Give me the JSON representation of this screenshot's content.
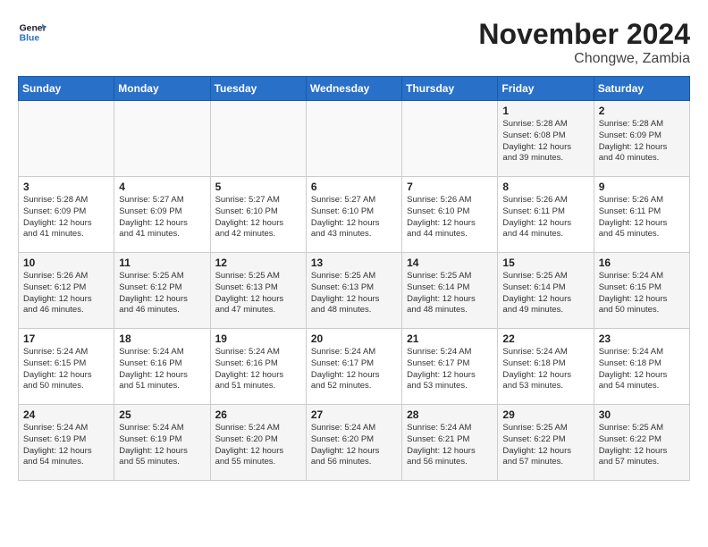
{
  "header": {
    "logo_line1": "General",
    "logo_line2": "Blue",
    "month": "November 2024",
    "location": "Chongwe, Zambia"
  },
  "days_of_week": [
    "Sunday",
    "Monday",
    "Tuesday",
    "Wednesday",
    "Thursday",
    "Friday",
    "Saturday"
  ],
  "weeks": [
    [
      {
        "day": "",
        "info": ""
      },
      {
        "day": "",
        "info": ""
      },
      {
        "day": "",
        "info": ""
      },
      {
        "day": "",
        "info": ""
      },
      {
        "day": "",
        "info": ""
      },
      {
        "day": "1",
        "info": "Sunrise: 5:28 AM\nSunset: 6:08 PM\nDaylight: 12 hours\nand 39 minutes."
      },
      {
        "day": "2",
        "info": "Sunrise: 5:28 AM\nSunset: 6:09 PM\nDaylight: 12 hours\nand 40 minutes."
      }
    ],
    [
      {
        "day": "3",
        "info": "Sunrise: 5:28 AM\nSunset: 6:09 PM\nDaylight: 12 hours\nand 41 minutes."
      },
      {
        "day": "4",
        "info": "Sunrise: 5:27 AM\nSunset: 6:09 PM\nDaylight: 12 hours\nand 41 minutes."
      },
      {
        "day": "5",
        "info": "Sunrise: 5:27 AM\nSunset: 6:10 PM\nDaylight: 12 hours\nand 42 minutes."
      },
      {
        "day": "6",
        "info": "Sunrise: 5:27 AM\nSunset: 6:10 PM\nDaylight: 12 hours\nand 43 minutes."
      },
      {
        "day": "7",
        "info": "Sunrise: 5:26 AM\nSunset: 6:10 PM\nDaylight: 12 hours\nand 44 minutes."
      },
      {
        "day": "8",
        "info": "Sunrise: 5:26 AM\nSunset: 6:11 PM\nDaylight: 12 hours\nand 44 minutes."
      },
      {
        "day": "9",
        "info": "Sunrise: 5:26 AM\nSunset: 6:11 PM\nDaylight: 12 hours\nand 45 minutes."
      }
    ],
    [
      {
        "day": "10",
        "info": "Sunrise: 5:26 AM\nSunset: 6:12 PM\nDaylight: 12 hours\nand 46 minutes."
      },
      {
        "day": "11",
        "info": "Sunrise: 5:25 AM\nSunset: 6:12 PM\nDaylight: 12 hours\nand 46 minutes."
      },
      {
        "day": "12",
        "info": "Sunrise: 5:25 AM\nSunset: 6:13 PM\nDaylight: 12 hours\nand 47 minutes."
      },
      {
        "day": "13",
        "info": "Sunrise: 5:25 AM\nSunset: 6:13 PM\nDaylight: 12 hours\nand 48 minutes."
      },
      {
        "day": "14",
        "info": "Sunrise: 5:25 AM\nSunset: 6:14 PM\nDaylight: 12 hours\nand 48 minutes."
      },
      {
        "day": "15",
        "info": "Sunrise: 5:25 AM\nSunset: 6:14 PM\nDaylight: 12 hours\nand 49 minutes."
      },
      {
        "day": "16",
        "info": "Sunrise: 5:24 AM\nSunset: 6:15 PM\nDaylight: 12 hours\nand 50 minutes."
      }
    ],
    [
      {
        "day": "17",
        "info": "Sunrise: 5:24 AM\nSunset: 6:15 PM\nDaylight: 12 hours\nand 50 minutes."
      },
      {
        "day": "18",
        "info": "Sunrise: 5:24 AM\nSunset: 6:16 PM\nDaylight: 12 hours\nand 51 minutes."
      },
      {
        "day": "19",
        "info": "Sunrise: 5:24 AM\nSunset: 6:16 PM\nDaylight: 12 hours\nand 51 minutes."
      },
      {
        "day": "20",
        "info": "Sunrise: 5:24 AM\nSunset: 6:17 PM\nDaylight: 12 hours\nand 52 minutes."
      },
      {
        "day": "21",
        "info": "Sunrise: 5:24 AM\nSunset: 6:17 PM\nDaylight: 12 hours\nand 53 minutes."
      },
      {
        "day": "22",
        "info": "Sunrise: 5:24 AM\nSunset: 6:18 PM\nDaylight: 12 hours\nand 53 minutes."
      },
      {
        "day": "23",
        "info": "Sunrise: 5:24 AM\nSunset: 6:18 PM\nDaylight: 12 hours\nand 54 minutes."
      }
    ],
    [
      {
        "day": "24",
        "info": "Sunrise: 5:24 AM\nSunset: 6:19 PM\nDaylight: 12 hours\nand 54 minutes."
      },
      {
        "day": "25",
        "info": "Sunrise: 5:24 AM\nSunset: 6:19 PM\nDaylight: 12 hours\nand 55 minutes."
      },
      {
        "day": "26",
        "info": "Sunrise: 5:24 AM\nSunset: 6:20 PM\nDaylight: 12 hours\nand 55 minutes."
      },
      {
        "day": "27",
        "info": "Sunrise: 5:24 AM\nSunset: 6:20 PM\nDaylight: 12 hours\nand 56 minutes."
      },
      {
        "day": "28",
        "info": "Sunrise: 5:24 AM\nSunset: 6:21 PM\nDaylight: 12 hours\nand 56 minutes."
      },
      {
        "day": "29",
        "info": "Sunrise: 5:25 AM\nSunset: 6:22 PM\nDaylight: 12 hours\nand 57 minutes."
      },
      {
        "day": "30",
        "info": "Sunrise: 5:25 AM\nSunset: 6:22 PM\nDaylight: 12 hours\nand 57 minutes."
      }
    ]
  ]
}
